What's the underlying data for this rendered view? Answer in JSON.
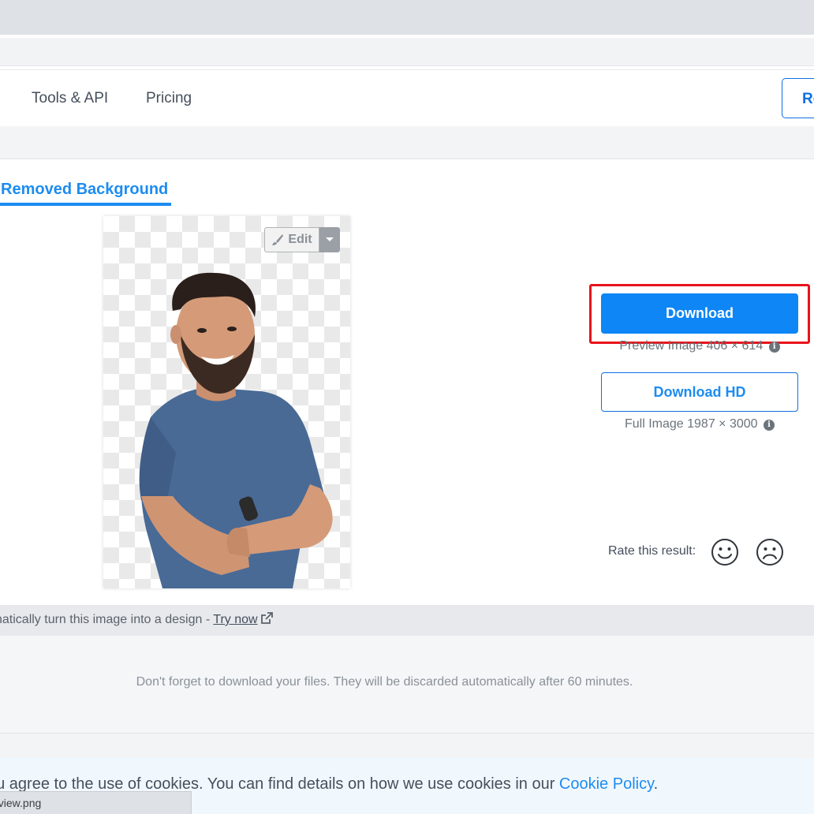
{
  "nav": {
    "tools_label": "Tools & API",
    "pricing_label": "Pricing",
    "right_button_label": "Re"
  },
  "tab": {
    "title": "Removed Background"
  },
  "editor": {
    "edit_label": "Edit"
  },
  "download": {
    "button_label": "Download",
    "preview_info": "Preview Image 406 × 614",
    "hd_button_label": "Download HD",
    "full_info": "Full Image 1987 × 3000",
    "highlight_color": "#e8141c",
    "accent_color": "#0f86f5"
  },
  "rating": {
    "label": "Rate this result:",
    "icons": [
      "smiley-icon",
      "frown-icon"
    ]
  },
  "design": {
    "text": "natically turn this image into a design - ",
    "link_label": "Try now"
  },
  "notice": {
    "text": "Don't forget to download your files. They will be discarded automatically after 60 minutes."
  },
  "cookie": {
    "text": "ou agree to the use of cookies. You can find details on how we use cookies in our ",
    "link_label": "Cookie Policy",
    "trailing": "."
  },
  "status_bar": {
    "text": "eview.png"
  }
}
